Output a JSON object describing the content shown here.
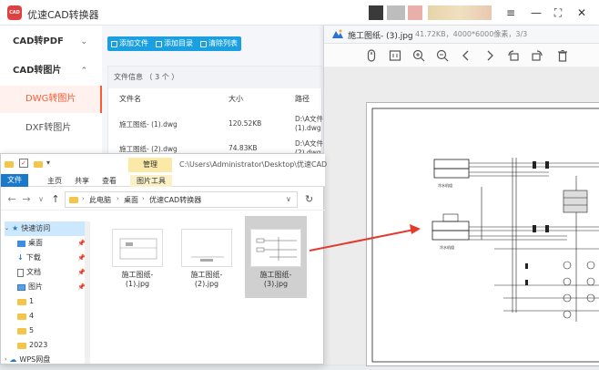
{
  "app": {
    "logo_text": "CAD",
    "title": "优速CAD转换器",
    "window_controls": {
      "menu": "≡",
      "minimize": "—",
      "maximize": "⛶",
      "close": "✕"
    },
    "sidebar": [
      {
        "label": "CAD转PDF",
        "chevron": "⌄",
        "children": []
      },
      {
        "label": "CAD转图片",
        "chevron": "⌃",
        "children": [
          {
            "label": "DWG转图片",
            "active": true
          },
          {
            "label": "DXF转图片",
            "active": false
          }
        ]
      }
    ],
    "toolbar": {
      "add_file": "添加文件",
      "add_folder": "添加目录",
      "clear_list": "清除列表"
    },
    "file_panel": {
      "info_label": "文件信息 （ 3 个 ）",
      "columns": [
        "文件名",
        "大小",
        "路径"
      ],
      "rows": [
        {
          "name": "施工图纸- (1).dwg",
          "size": "120.52KB",
          "path_line1": "D:\\A文件",
          "path_line2": "(1).dwg"
        },
        {
          "name": "施工图纸- (2).dwg",
          "size": "74.83KB",
          "path_line1": "D:\\A文件",
          "path_line2": "(2).dwg"
        }
      ]
    },
    "colors": {
      "accent": "#ff5b33",
      "toolbar_blue": "#1aa0e0"
    }
  },
  "viewer": {
    "file_name": "施工图纸- (3).jpg",
    "meta": "41.72KB，4000*6000像素，3/3",
    "tools": [
      "mouse-icon",
      "fit-icon",
      "zoom-in-icon",
      "zoom-out-icon",
      "prev-icon",
      "next-icon",
      "rotate-left-icon",
      "rotate-right-icon",
      "delete-icon"
    ],
    "drawing_labels": {
      "tag_a": "冷水机组",
      "tag_b": "冷水机组"
    }
  },
  "explorer": {
    "manage_tab": "管理",
    "picture_tools": "图片工具",
    "path_title": "C:\\Users\\Administrator\\Desktop\\优速CAD",
    "tabs": [
      "文件",
      "主页",
      "共享",
      "查看"
    ],
    "breadcrumb": [
      "此电脑",
      "桌面",
      "优速CAD转换器"
    ],
    "tree": [
      {
        "label": "快速访问",
        "type": "star",
        "pinned": false
      },
      {
        "label": "桌面",
        "type": "desktop",
        "pinned": true
      },
      {
        "label": "下载",
        "type": "download",
        "pinned": true
      },
      {
        "label": "文档",
        "type": "doc",
        "pinned": true
      },
      {
        "label": "图片",
        "type": "pic",
        "pinned": true
      },
      {
        "label": "1",
        "type": "folder",
        "pinned": false
      },
      {
        "label": "4",
        "type": "folder",
        "pinned": false
      },
      {
        "label": "5",
        "type": "folder",
        "pinned": false
      },
      {
        "label": "2023",
        "type": "folder",
        "pinned": false
      },
      {
        "label": "WPS网盘",
        "type": "cloud",
        "pinned": false
      }
    ],
    "files": [
      {
        "line1": "施工图纸-",
        "line2": "(1).jpg",
        "selected": false
      },
      {
        "line1": "施工图纸-",
        "line2": "(2).jpg",
        "selected": false
      },
      {
        "line1": "施工图纸-",
        "line2": "(3).jpg",
        "selected": true
      }
    ]
  }
}
